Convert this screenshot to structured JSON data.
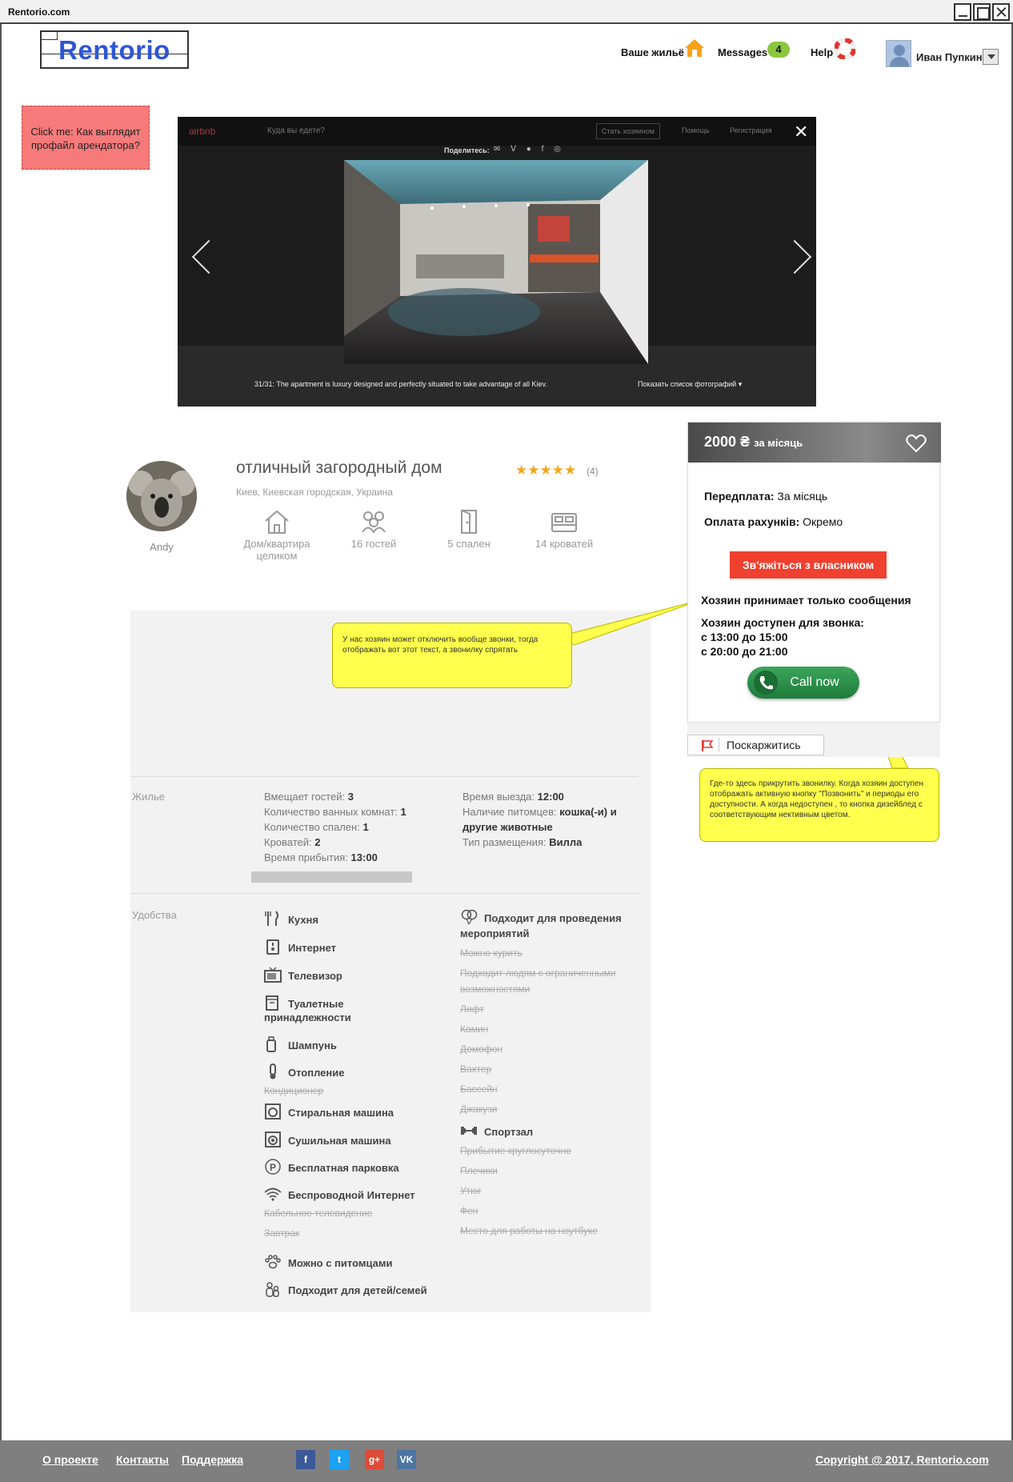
{
  "window": {
    "title": "Rentorio.com"
  },
  "header": {
    "logo": "Rentorio",
    "nav_home": "Ваше жильё",
    "nav_messages": "Messages",
    "messages_count": "4",
    "nav_help": "Help",
    "user_name": "Иван Пупкин"
  },
  "click_note": "Click me: Как выглядит профайл арендатора?",
  "gallery": {
    "brand": "airbnb",
    "search_placeholder": "Куда вы едете?",
    "host_button": "Стать хозяином",
    "nav_help": "Помощь",
    "nav_signup": "Регистрация",
    "share_label": "Поделитесь:",
    "caption": "31/31: The apartment is luxury designed and perfectly situated to take advantage of all Kiev.",
    "show_list": "Показать список фотографий ▾"
  },
  "listing": {
    "host_name": "Andy",
    "title": "отличный загородный дом",
    "location": "Киев, Киевская городская, Украина",
    "stars": "★★★★★",
    "reviews": "(4)",
    "features": [
      {
        "label": "Дом/квартира целиком",
        "icon": "house-icon"
      },
      {
        "label": "16 гостей",
        "icon": "guests-icon"
      },
      {
        "label": "5 спален",
        "icon": "door-icon"
      },
      {
        "label": "14 кроватей",
        "icon": "bed-icon"
      }
    ]
  },
  "notes": {
    "calls_disabled": "У нас хозяин может отключить вообще звонки, тогда отображать вот этот текст, а звонилку спрятать",
    "call_widget": "Где-то здесь прикрутить звонилку. Когда хозяин доступен отображать активную кнопку \"Позвонить\" и периоды его доступности. А когда недоступен , то кнопка дизейблед с соответствующим нективным цветом."
  },
  "housing": {
    "label": "Жилье",
    "left": [
      {
        "key": "Вмещает гостей:",
        "value": "3"
      },
      {
        "key": "Количество ванных комнат:",
        "value": "1"
      },
      {
        "key": "Количество спален:",
        "value": "1"
      },
      {
        "key": "Кроватей:",
        "value": "2"
      },
      {
        "key": "Время прибытия:",
        "value": "13:00"
      }
    ],
    "right": [
      {
        "key": "Время выезда:",
        "value": "12:00"
      },
      {
        "key": "Наличие питомцев:",
        "value": "кошка(-и) и"
      },
      {
        "key": "",
        "value": "другие животные"
      },
      {
        "key": "Тип размещения:",
        "value": "Вилла"
      }
    ]
  },
  "amenities": {
    "label": "Удобства",
    "left": [
      {
        "label": "Кухня",
        "icon": "fork-knife-icon",
        "available": true
      },
      {
        "label": "Интернет",
        "icon": "router-icon",
        "available": true
      },
      {
        "label": "Телевизор",
        "icon": "tv-icon",
        "available": true
      },
      {
        "label": "Туалетные",
        "icon": "toiletries-icon",
        "available": true
      },
      {
        "label": "принадлежности",
        "icon": "",
        "available": true
      },
      {
        "label": "Шампунь",
        "icon": "shampoo-icon",
        "available": true
      },
      {
        "label": "Отопление",
        "icon": "thermometer-icon",
        "available": true
      },
      {
        "label": "Кондиционер",
        "icon": "",
        "available": false
      },
      {
        "label": "Стиральная машина",
        "icon": "washer-icon",
        "available": true
      },
      {
        "label": "Сушильная машина",
        "icon": "dryer-icon",
        "available": true
      },
      {
        "label": "Бесплатная парковка",
        "icon": "parking-icon",
        "available": true
      },
      {
        "label": "Беспроводной Интернет",
        "icon": "wifi-icon",
        "available": true
      },
      {
        "label": "Кабельное телевидение",
        "icon": "",
        "available": false
      },
      {
        "label": "Завтрак",
        "icon": "",
        "available": false
      },
      {
        "label": "Можно с питомцами",
        "icon": "paw-icon",
        "available": true
      },
      {
        "label": "Подходит для детей/семей",
        "icon": "family-icon",
        "available": true
      }
    ],
    "right": [
      {
        "label": "Подходит для проведения",
        "icon": "balloon-icon",
        "available": true
      },
      {
        "label": "мероприятий",
        "icon": "",
        "available": true
      },
      {
        "label": "Можно курить",
        "icon": "",
        "available": false
      },
      {
        "label": "Подходит людям с ограниченными",
        "icon": "",
        "available": false
      },
      {
        "label": "возможностями",
        "icon": "",
        "available": false
      },
      {
        "label": "Лифт",
        "icon": "",
        "available": false
      },
      {
        "label": "Камин",
        "icon": "",
        "available": false
      },
      {
        "label": "Домофон",
        "icon": "",
        "available": false
      },
      {
        "label": "Вахтер",
        "icon": "",
        "available": false
      },
      {
        "label": "Бассейн",
        "icon": "",
        "available": false
      },
      {
        "label": "Джакузи",
        "icon": "",
        "available": false
      },
      {
        "label": "Спортзал",
        "icon": "dumbbell-icon",
        "available": true
      },
      {
        "label": "Прибытие круглосуточно",
        "icon": "",
        "available": false
      },
      {
        "label": "Плечики",
        "icon": "",
        "available": false
      },
      {
        "label": "Утюг",
        "icon": "",
        "available": false
      },
      {
        "label": "Фен",
        "icon": "",
        "available": false
      },
      {
        "label": "Место для работы на ноутбуке",
        "icon": "",
        "available": false
      }
    ]
  },
  "price_card": {
    "price": "2000 ₴",
    "period": "за місяць",
    "prepay_key": "Передплата:",
    "prepay_value": "За місяць",
    "bills_key": "Оплата рахунків:",
    "bills_value": "Окремо",
    "contact_button": "Зв'яжіться з власником",
    "messages_only": "Хозяин принимает только сообщения",
    "available_title": "Хозяин доступен для звонка:",
    "slot1": "с 13:00 до 15:00",
    "slot2": "с 20:00 до 21:00",
    "call_button": "Call now",
    "report_button": "Поскаржитись"
  },
  "footer": {
    "about": "О проекте",
    "contacts": "Контакты",
    "support": "Поддержка",
    "social": [
      "f",
      "t",
      "g+",
      "VK"
    ],
    "copyright": "Copyright @ 2017, Rentorio.com"
  },
  "colors": {
    "accent_red": "#f0402f",
    "call_green": "#2a8f48",
    "note_yellow": "#ffff4d",
    "note_red": "#f77a7a",
    "logo_blue": "#2d55d6"
  }
}
